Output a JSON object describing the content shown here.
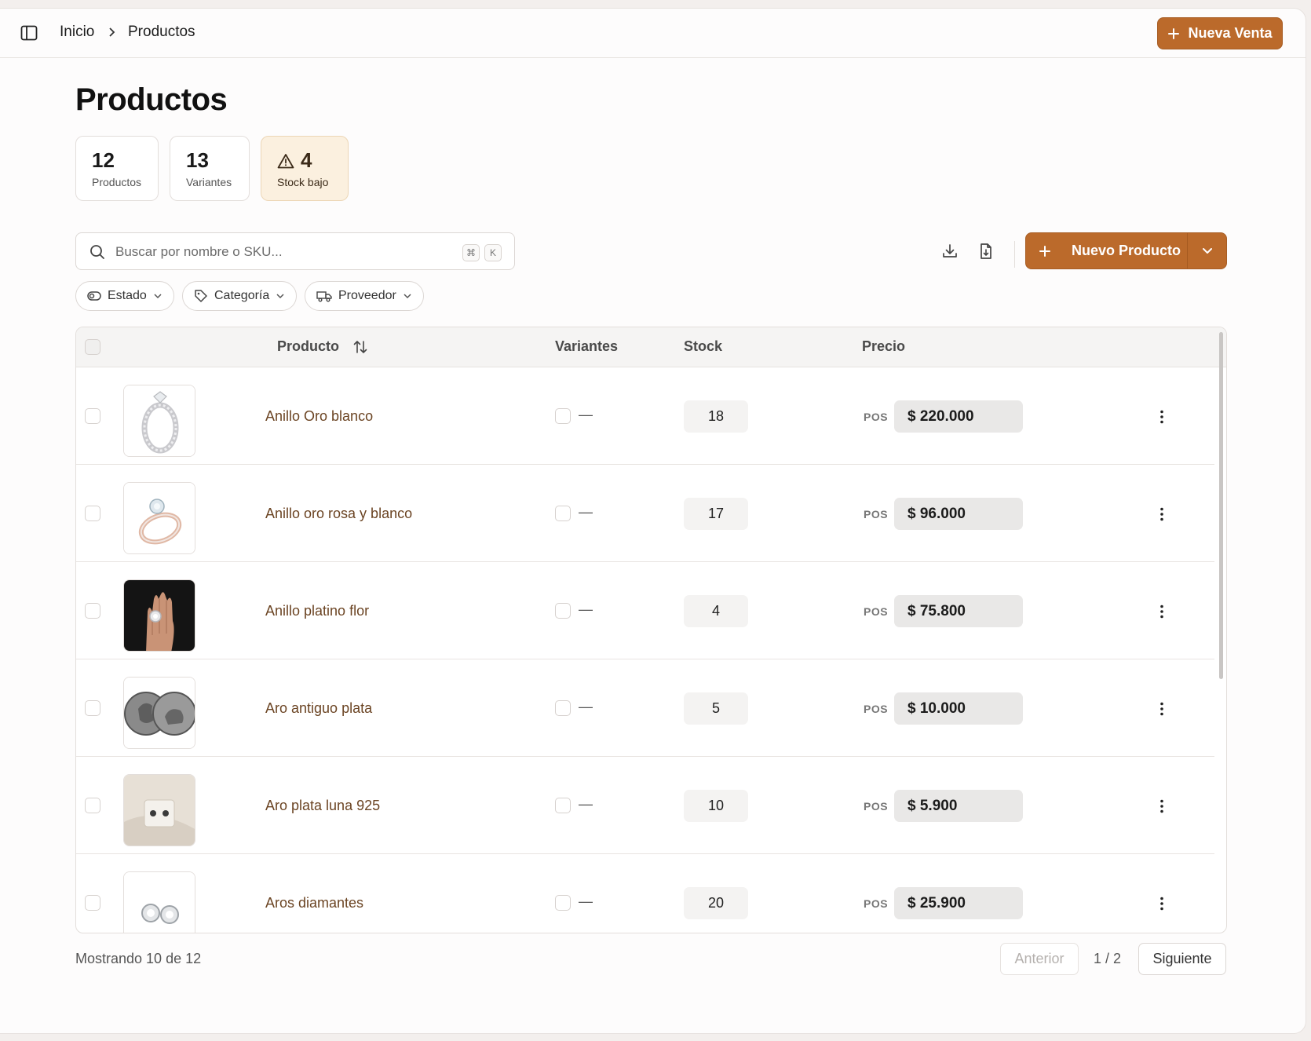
{
  "breadcrumb": {
    "home": "Inicio",
    "current": "Productos"
  },
  "header": {
    "new_sale_label": "Nueva Venta"
  },
  "page": {
    "title": "Productos"
  },
  "stats": [
    {
      "value": "12",
      "label": "Productos"
    },
    {
      "value": "13",
      "label": "Variantes"
    },
    {
      "value": "4",
      "label": "Stock bajo"
    }
  ],
  "search": {
    "placeholder": "Buscar por nombre o SKU...",
    "shortcut_mod": "⌘",
    "shortcut_key": "K"
  },
  "toolbar": {
    "new_product_label": "Nuevo Producto"
  },
  "filters": {
    "estado": "Estado",
    "categoria": "Categoría",
    "proveedor": "Proveedor"
  },
  "table": {
    "columns": {
      "producto": "Producto",
      "variantes": "Variantes",
      "stock": "Stock",
      "precio": "Precio"
    },
    "rows": [
      {
        "name": "Anillo Oro blanco",
        "variants": "—",
        "stock": "18",
        "channel": "POS",
        "price": "$ 220.000",
        "image": "white-gold-ring"
      },
      {
        "name": "Anillo oro rosa y blanco",
        "variants": "—",
        "stock": "17",
        "channel": "POS",
        "price": "$ 96.000",
        "image": "rose-gold-ring"
      },
      {
        "name": "Anillo platino flor",
        "variants": "—",
        "stock": "4",
        "channel": "POS",
        "price": "$ 75.800",
        "image": "hand-with-ring"
      },
      {
        "name": "Aro antiguo plata",
        "variants": "—",
        "stock": "5",
        "channel": "POS",
        "price": "$ 10.000",
        "image": "silver-coins"
      },
      {
        "name": "Aro plata luna 925",
        "variants": "—",
        "stock": "10",
        "channel": "POS",
        "price": "$ 5.900",
        "image": "moon-earrings"
      },
      {
        "name": "Aros diamantes",
        "variants": "—",
        "stock": "20",
        "channel": "POS",
        "price": "$ 25.900",
        "image": "diamond-earrings"
      }
    ]
  },
  "footer": {
    "showing": "Mostrando 10 de 12",
    "prev": "Anterior",
    "page": "1 / 2",
    "next": "Siguiente"
  },
  "colors": {
    "accent": "#bb6a2b",
    "warning_bg": "#fbf0df",
    "product_link": "#6b4423"
  }
}
